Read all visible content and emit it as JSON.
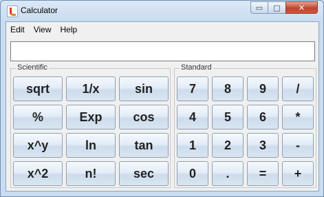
{
  "window": {
    "title": "Calculator",
    "controls": {
      "minimize": "▭",
      "maximize": "□",
      "close": "✕"
    }
  },
  "menu": [
    "Edit",
    "View",
    "Help"
  ],
  "display": {
    "value": ""
  },
  "panels": {
    "scientific": {
      "label": "Scientific",
      "buttons": [
        "sqrt",
        "1/x",
        "sin",
        "%",
        "Exp",
        "cos",
        "x^y",
        "ln",
        "tan",
        "x^2",
        "n!",
        "sec"
      ]
    },
    "standard": {
      "label": "Standard",
      "buttons": [
        "7",
        "8",
        "9",
        "/",
        "4",
        "5",
        "6",
        "*",
        "1",
        "2",
        "3",
        "-",
        "0",
        ".",
        "=",
        "+"
      ]
    }
  }
}
